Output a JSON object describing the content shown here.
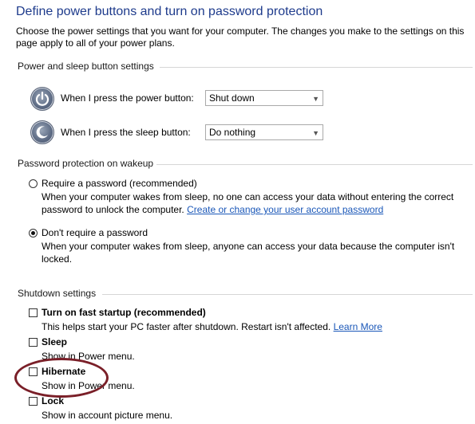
{
  "header": {
    "title": "Define power buttons and turn on password protection",
    "description_line1": "Choose the power settings that you want for your computer. The changes you make to the settings on this",
    "description_line2": "page apply to all of your power plans."
  },
  "power_sleep": {
    "heading": "Power and sleep button settings",
    "power_label": "When I press the power button:",
    "power_value": "Shut down",
    "sleep_label": "When I press the sleep button:",
    "sleep_value": "Do nothing"
  },
  "password": {
    "heading": "Password protection on wakeup",
    "require_label": "Require a password (recommended)",
    "require_desc1": "When your computer wakes from sleep, no one can access your data without entering the correct",
    "require_desc2_prefix": "password to unlock the computer.",
    "require_link": "Create or change your user account password",
    "norequire_label": "Don't require a password",
    "norequire_desc1": "When your computer wakes from sleep, anyone can access your data because the computer isn't",
    "norequire_desc2": "locked.",
    "selected": "dont_require"
  },
  "shutdown": {
    "heading": "Shutdown settings",
    "fast_startup_label": "Turn on fast startup (recommended)",
    "fast_startup_desc": "This helps start your PC faster after shutdown. Restart isn't affected.",
    "learn_more": "Learn More",
    "sleep_label": "Sleep",
    "sleep_desc": "Show in Power menu.",
    "hibernate_label": "Hibernate",
    "hibernate_desc": "Show in Power menu.",
    "lock_label": "Lock",
    "lock_desc": "Show in account picture menu.",
    "checked": {
      "fast_startup": false,
      "sleep": false,
      "hibernate": false,
      "lock": false
    }
  },
  "colors": {
    "title": "#1e3b8c",
    "link": "#1a57b8",
    "annotation_circle": "#7a1f28"
  },
  "icons": {
    "power": "power-button-icon",
    "sleep": "sleep-button-icon",
    "dropdown": "chevron-down-icon"
  }
}
